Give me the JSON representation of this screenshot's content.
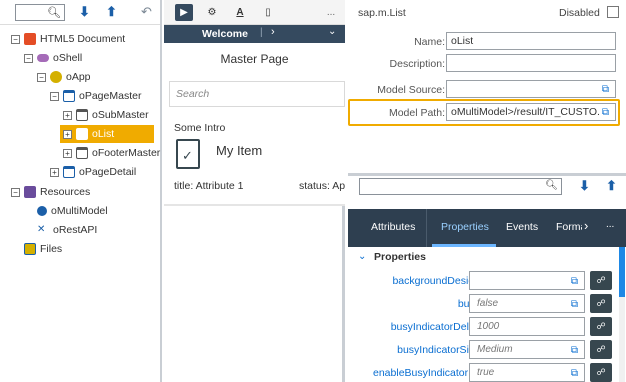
{
  "left_toolbar": {
    "search_placeholder": "",
    "search_icon": "search-icon",
    "expand_icon": "chevron-double-down-icon",
    "collapse_icon": "chevron-double-up-icon",
    "back_icon": "undo-icon"
  },
  "tree": [
    {
      "label": "HTML5 Document",
      "icon": "html5-icon",
      "toggle": "⊟"
    },
    {
      "label": "oShell",
      "icon": "shell-icon",
      "toggle": "⊟"
    },
    {
      "label": "oApp",
      "icon": "app-icon",
      "toggle": "⊟"
    },
    {
      "label": "oPageMaster",
      "icon": "page-icon",
      "toggle": "⊟"
    },
    {
      "label": "oSubMaster",
      "icon": "page-icon",
      "toggle": "⊞"
    },
    {
      "label": "oList",
      "icon": "list-icon",
      "toggle": "⊞"
    },
    {
      "label": "oFooterMaster",
      "icon": "page-icon",
      "toggle": "⊞"
    },
    {
      "label": "oPageDetail",
      "icon": "page-icon",
      "toggle": "⊞"
    },
    {
      "label": "Resources",
      "icon": "resources-icon",
      "toggle": "⊟"
    },
    {
      "label": "oMultiModel",
      "icon": "model-icon",
      "toggle": ""
    },
    {
      "label": "oRestAPI",
      "icon": "api-icon",
      "toggle": ""
    },
    {
      "label": "Files",
      "icon": "files-icon",
      "toggle": ""
    }
  ],
  "preview": {
    "tab_label": "Welcome",
    "nav_icon": "chevron-right-icon",
    "dropdown_icon": "chevron-down-icon",
    "more_label": "...",
    "page_title": "Master Page",
    "search_placeholder": "Search",
    "intro_text": "Some Intro",
    "item_title": "My Item",
    "attr_text": "title: Attribute 1",
    "status_text": "status: App"
  },
  "control": {
    "type_label": "sap.m.List",
    "disabled_label": "Disabled",
    "fields": [
      {
        "label": "Name:",
        "value": "oList"
      },
      {
        "label": "Description:",
        "value": ""
      },
      {
        "label": "Model Source:",
        "value": ""
      },
      {
        "label": "Model Path:",
        "value": "oMultiModel>/result/IT_CUSTO..."
      }
    ]
  },
  "inspector": {
    "search_placeholder": "",
    "tabs": [
      "Attributes",
      "Properties",
      "Events",
      "Forma"
    ],
    "active_tab": "Properties",
    "more_label": "...",
    "section_title": "Properties",
    "properties": [
      {
        "name": "backgroundDesign",
        "value": ""
      },
      {
        "name": "busy",
        "value": "false"
      },
      {
        "name": "busyIndicatorDelay",
        "value": "1000"
      },
      {
        "name": "busyIndicatorSize",
        "value": "Medium"
      },
      {
        "name": "enableBusyIndicator",
        "value": "true"
      }
    ]
  },
  "colors": {
    "accent": "#f0ab00",
    "shell": "#354a5f",
    "tabs": "#2e3f50",
    "link": "#0a6ed1"
  }
}
